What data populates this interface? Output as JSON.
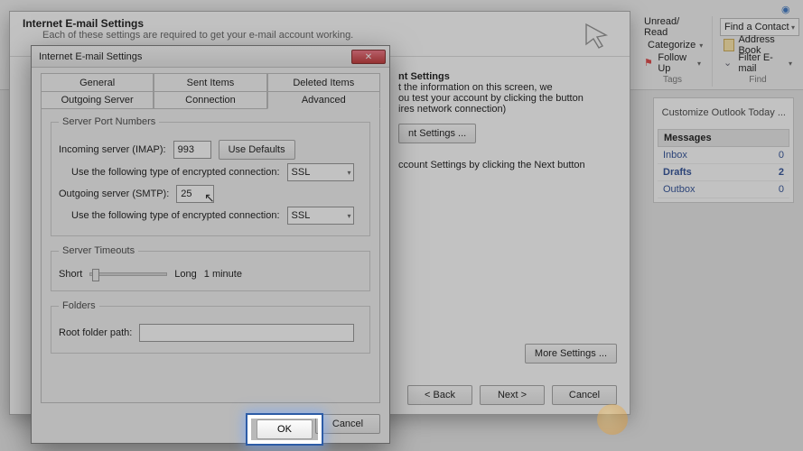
{
  "ribbon": {
    "tags": {
      "unread": "Unread/ Read",
      "categorize": "Categorize",
      "followup": "Follow Up",
      "label": "Tags"
    },
    "find": {
      "contact": "Find a Contact",
      "address": "Address Book",
      "filter": "Filter E-mail",
      "label": "Find"
    }
  },
  "rightPane": {
    "customize": "Customize Outlook Today ...",
    "messagesHdr": "Messages",
    "rows": [
      {
        "name": "Inbox",
        "count": "0"
      },
      {
        "name": "Drafts",
        "count": "2"
      },
      {
        "name": "Outbox",
        "count": "0"
      }
    ]
  },
  "wizard": {
    "title": "Internet E-mail Settings",
    "sub": "Each of these settings are required to get your e-mail account working.",
    "sectionHdr": "nt Settings",
    "line1": "t the information on this screen, we",
    "line2": "ou test your account by clicking the button",
    "line3": "ires network connection)",
    "testBtn": "nt Settings ...",
    "nextHint": "ccount Settings by clicking the Next button",
    "moreBtn": "More Settings ...",
    "back": "< Back",
    "next": "Next >",
    "cancel": "Cancel"
  },
  "dialog": {
    "title": "Internet E-mail Settings",
    "tabs": {
      "general": "General",
      "sent": "Sent Items",
      "deleted": "Deleted Items",
      "outgoing": "Outgoing Server",
      "connection": "Connection",
      "advanced": "Advanced"
    },
    "spn": {
      "legend": "Server Port Numbers",
      "incoming": "Incoming server (IMAP):",
      "incomingVal": "993",
      "defaults": "Use Defaults",
      "encLabel": "Use the following type of encrypted connection:",
      "enc1": "SSL",
      "outgoing": "Outgoing server (SMTP):",
      "outgoingVal": "25",
      "enc2": "SSL"
    },
    "timeouts": {
      "legend": "Server Timeouts",
      "short": "Short",
      "long": "Long",
      "val": "1 minute"
    },
    "folders": {
      "legend": "Folders",
      "root": "Root folder path:",
      "val": ""
    },
    "ok": "OK",
    "cancel": "Cancel"
  }
}
